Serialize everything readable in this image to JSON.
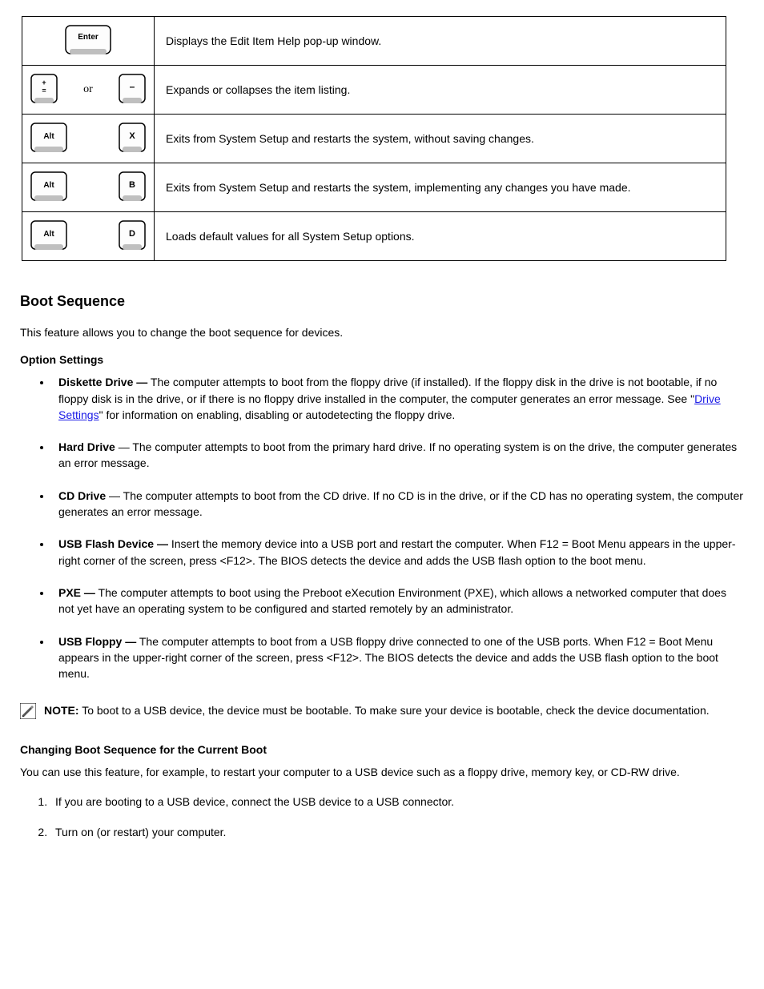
{
  "table": {
    "rows": [
      {
        "desc": "Displays the Edit Item Help pop-up window."
      },
      {
        "desc": "Expands or collapses the item listing."
      },
      {
        "desc": "Exits from System Setup and restarts the system, without saving changes."
      },
      {
        "desc": "Exits from System Setup and restarts the system, implementing any changes you have made."
      },
      {
        "desc": "Loads default values for all System Setup options."
      }
    ]
  },
  "keys": {
    "enter": "Enter",
    "plus_equals_top": "+",
    "plus_equals_bottom": "=",
    "minus": "–",
    "alt": "Alt",
    "x": "X",
    "b": "B",
    "d": "D",
    "or": "or"
  },
  "section": {
    "title": "Boot Sequence",
    "intro": "This feature allows you to change the boot sequence for devices.",
    "options_title": "Option Settings",
    "bullets": [
      {
        "prefix_bold": "Diskette Drive —",
        "body_a": " The computer attempts to boot from the floppy drive (if installed). If the floppy disk in the drive is not bootable, if no floppy disk is in the drive, or if there is no floppy drive installed in the computer, the computer generates an error message. See \"",
        "link": "Drive Settings",
        "body_b": "\" for information on enabling, disabling or autodetecting the floppy drive."
      },
      {
        "prefix_bold": "Hard Drive",
        "body_a": " — The computer attempts to boot from the primary hard drive. If no operating system is on the drive, the computer generates an error message."
      },
      {
        "prefix_bold": "CD Drive",
        "body_a": " — The computer attempts to boot from the CD drive. If no CD is in the drive, or if the CD has no operating system, the computer generates an error message."
      },
      {
        "prefix_bold": "USB Flash Device —",
        "body_a": " Insert the memory device into a USB port and restart the computer. When ",
        "code": "F12 = Boot Menu",
        "body_b": " appears in the upper-right corner of the screen, press <F12>. The BIOS detects the device and adds the USB flash option to the boot menu."
      },
      {
        "prefix_bold": "PXE —",
        "body_a": " The computer attempts to boot using the Preboot eXecution Environment (PXE), which allows a networked computer that does not yet have an operating system to be configured and started remotely by an administrator."
      },
      {
        "prefix_bold": "USB Floppy —",
        "body_a": " The computer attempts to boot from a USB floppy drive connected to one of the USB ports. When ",
        "code": "F12 = Boot Menu",
        "body_b": " appears in the upper-right corner of the screen, press <F12>. The BIOS detects the device and adds the USB flash option to the boot menu."
      }
    ],
    "note_label": "NOTE:",
    "note_body": " To boot to a USB device, the device must be bootable. To make sure your device is bootable, check the device documentation.",
    "instr_title": "Changing Boot Sequence for the Current Boot",
    "instr_para": "You can use this feature, for example, to restart your computer to a USB device such as a floppy drive, memory key, or CD-RW drive.",
    "steps": [
      "If you are booting to a USB device, connect the USB device to a USB connector.",
      "Turn on (or restart) your computer."
    ]
  }
}
